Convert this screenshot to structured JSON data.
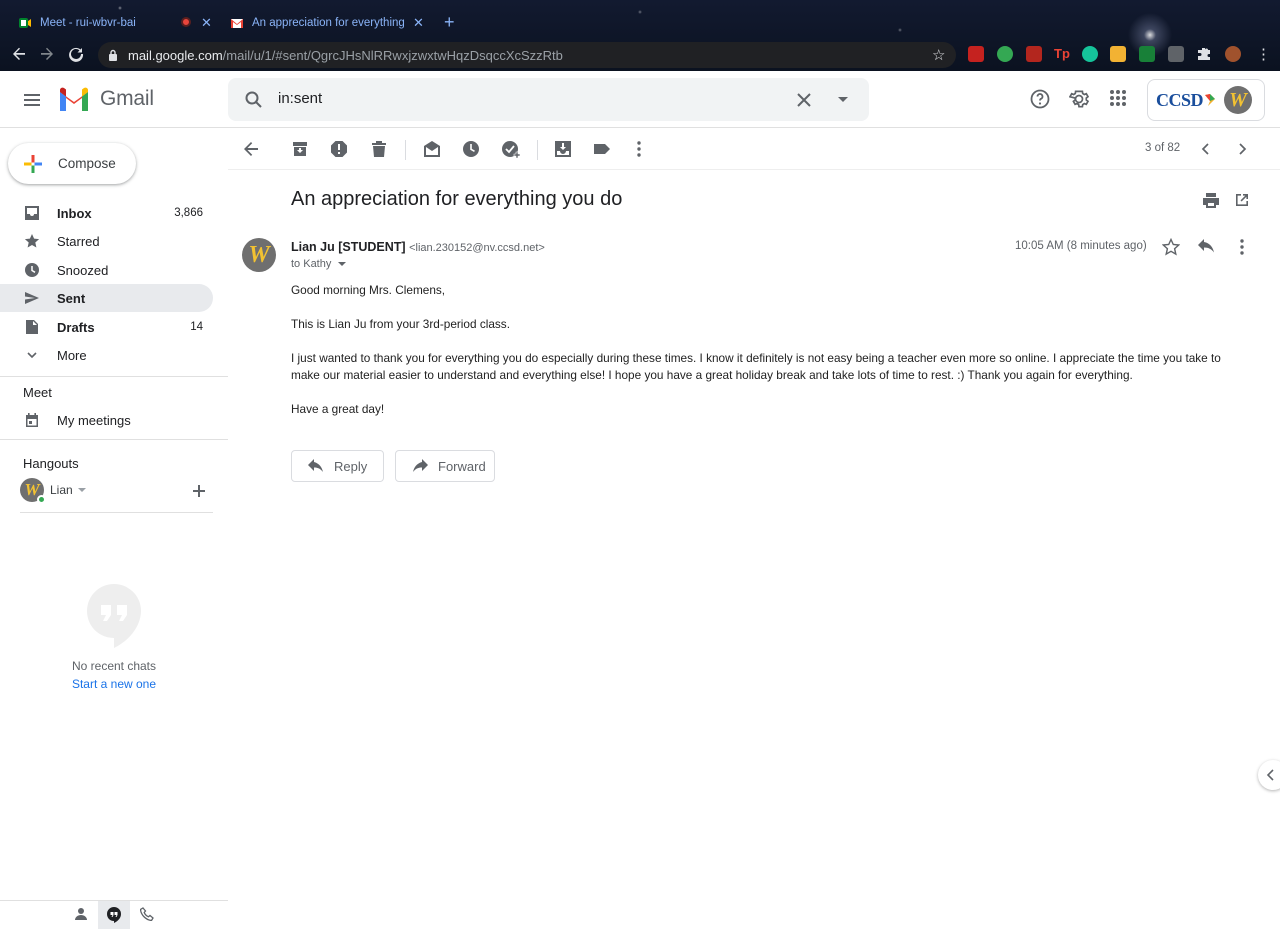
{
  "browser": {
    "tabs": [
      {
        "title": "Meet - rui-wbvr-bai",
        "favicon": "google-meet-icon",
        "recording": true
      },
      {
        "title": "An appreciation for everything",
        "favicon": "gmail-icon",
        "active": true
      }
    ],
    "url_host": "mail.google.com",
    "url_path": "/mail/u/1/#sent/QgrcJHsNlRRwxjzwxtwHqzDsqccXcSzzRtb"
  },
  "header": {
    "app_name": "Gmail",
    "search_value": "in:sent",
    "account_logo_text": "CCSD"
  },
  "sidebar": {
    "compose_label": "Compose",
    "items": [
      {
        "label": "Inbox",
        "count": "3,866",
        "icon": "inbox-icon",
        "bold": true
      },
      {
        "label": "Starred",
        "count": "",
        "icon": "star-icon"
      },
      {
        "label": "Snoozed",
        "count": "",
        "icon": "clock-icon"
      },
      {
        "label": "Sent",
        "count": "",
        "icon": "send-icon",
        "bold": true,
        "active": true
      },
      {
        "label": "Drafts",
        "count": "14",
        "icon": "draft-icon",
        "bold": true
      },
      {
        "label": "More",
        "count": "",
        "icon": "chevron-down-icon"
      }
    ],
    "meet_title": "Meet",
    "meet_item": "My meetings",
    "hangouts_title": "Hangouts",
    "hangouts_user": "Lian",
    "no_chats": "No recent chats",
    "start_new": "Start a new one"
  },
  "toolbar": {
    "pager": "3 of 82"
  },
  "message": {
    "subject": "An appreciation for everything you do",
    "sender_name": "Lian Ju [STUDENT]",
    "sender_email": "<lian.230152@nv.ccsd.net>",
    "to": "to Kathy",
    "time": "10:05 AM (8 minutes ago)",
    "body": [
      "Good morning Mrs. Clemens,",
      "This is Lian Ju from your 3rd-period class.",
      "I just wanted to thank you for everything you do especially during these times. I know it definitely is not easy being a teacher even more so online. I appreciate the time you take to make our material easier to understand and everything else! I hope you have a great holiday break and take lots of time to rest. :) Thank you again for everything.",
      "Have a great day!"
    ],
    "reply_label": "Reply",
    "forward_label": "Forward"
  },
  "colors": {
    "accent": "#1a73e8",
    "active_nav_bg": "#e8eaed",
    "avatar_bg": "#6f6f6f",
    "avatar_letter": "#f2c232"
  }
}
